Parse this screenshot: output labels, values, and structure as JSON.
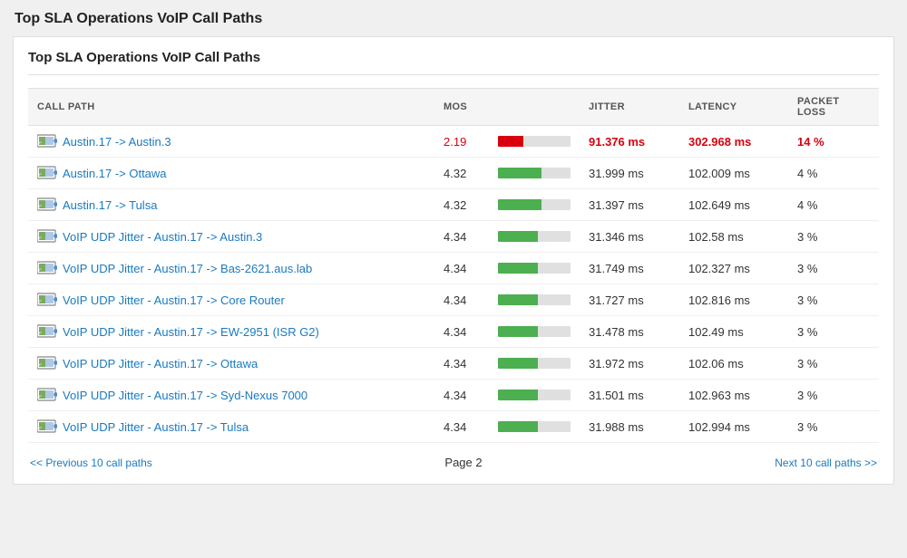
{
  "page": {
    "outer_title": "Top SLA Operations VoIP Call Paths",
    "inner_title": "Top SLA Operations VoIP Call Paths"
  },
  "table": {
    "columns": [
      "CALL PATH",
      "MOS",
      "",
      "JITTER",
      "LATENCY",
      "PACKET LOSS"
    ],
    "rows": [
      {
        "call_path": "Austin.17 -> Austin.3",
        "mos": "2.19",
        "mos_class": "mos-red",
        "bar_pct": 35,
        "bar_class": "bar-fill-red",
        "jitter": "91.376 ms",
        "jitter_class": "jitter-red",
        "latency": "302.968 ms",
        "latency_class": "latency-red",
        "packet_loss": "14 %",
        "packet_class": "packet-red"
      },
      {
        "call_path": "Austin.17 -> Ottawa",
        "mos": "4.32",
        "mos_class": "mos-normal",
        "bar_pct": 60,
        "bar_class": "bar-fill-green",
        "jitter": "31.999 ms",
        "jitter_class": "jitter-normal",
        "latency": "102.009 ms",
        "latency_class": "latency-normal",
        "packet_loss": "4 %",
        "packet_class": "packet-normal"
      },
      {
        "call_path": "Austin.17 -> Tulsa",
        "mos": "4.32",
        "mos_class": "mos-normal",
        "bar_pct": 60,
        "bar_class": "bar-fill-green",
        "jitter": "31.397 ms",
        "jitter_class": "jitter-normal",
        "latency": "102.649 ms",
        "latency_class": "latency-normal",
        "packet_loss": "4 %",
        "packet_class": "packet-normal"
      },
      {
        "call_path": "VoIP UDP Jitter - Austin.17 -> Austin.3",
        "mos": "4.34",
        "mos_class": "mos-normal",
        "bar_pct": 55,
        "bar_class": "bar-fill-green",
        "jitter": "31.346 ms",
        "jitter_class": "jitter-normal",
        "latency": "102.58 ms",
        "latency_class": "latency-normal",
        "packet_loss": "3 %",
        "packet_class": "packet-normal"
      },
      {
        "call_path": "VoIP UDP Jitter - Austin.17 -> Bas-2621.aus.lab",
        "mos": "4.34",
        "mos_class": "mos-normal",
        "bar_pct": 55,
        "bar_class": "bar-fill-green",
        "jitter": "31.749 ms",
        "jitter_class": "jitter-normal",
        "latency": "102.327 ms",
        "latency_class": "latency-normal",
        "packet_loss": "3 %",
        "packet_class": "packet-normal"
      },
      {
        "call_path": "VoIP UDP Jitter - Austin.17 -> Core Router",
        "mos": "4.34",
        "mos_class": "mos-normal",
        "bar_pct": 55,
        "bar_class": "bar-fill-green",
        "jitter": "31.727 ms",
        "jitter_class": "jitter-normal",
        "latency": "102.816 ms",
        "latency_class": "latency-normal",
        "packet_loss": "3 %",
        "packet_class": "packet-normal"
      },
      {
        "call_path": "VoIP UDP Jitter - Austin.17 -> EW-2951 (ISR G2)",
        "mos": "4.34",
        "mos_class": "mos-normal",
        "bar_pct": 55,
        "bar_class": "bar-fill-green",
        "jitter": "31.478 ms",
        "jitter_class": "jitter-normal",
        "latency": "102.49 ms",
        "latency_class": "latency-normal",
        "packet_loss": "3 %",
        "packet_class": "packet-normal"
      },
      {
        "call_path": "VoIP UDP Jitter - Austin.17 -> Ottawa",
        "mos": "4.34",
        "mos_class": "mos-normal",
        "bar_pct": 55,
        "bar_class": "bar-fill-green",
        "jitter": "31.972 ms",
        "jitter_class": "jitter-normal",
        "latency": "102.06 ms",
        "latency_class": "latency-normal",
        "packet_loss": "3 %",
        "packet_class": "packet-normal"
      },
      {
        "call_path": "VoIP UDP Jitter - Austin.17 -> Syd-Nexus 7000",
        "mos": "4.34",
        "mos_class": "mos-normal",
        "bar_pct": 55,
        "bar_class": "bar-fill-green",
        "jitter": "31.501 ms",
        "jitter_class": "jitter-normal",
        "latency": "102.963 ms",
        "latency_class": "latency-normal",
        "packet_loss": "3 %",
        "packet_class": "packet-normal"
      },
      {
        "call_path": "VoIP UDP Jitter - Austin.17 -> Tulsa",
        "mos": "4.34",
        "mos_class": "mos-normal",
        "bar_pct": 55,
        "bar_class": "bar-fill-green",
        "jitter": "31.988 ms",
        "jitter_class": "jitter-normal",
        "latency": "102.994 ms",
        "latency_class": "latency-normal",
        "packet_loss": "3 %",
        "packet_class": "packet-normal"
      }
    ]
  },
  "pagination": {
    "prev_label": "<< Previous 10 call paths",
    "page_label": "Page 2",
    "next_label": "Next 10 call paths >>"
  }
}
